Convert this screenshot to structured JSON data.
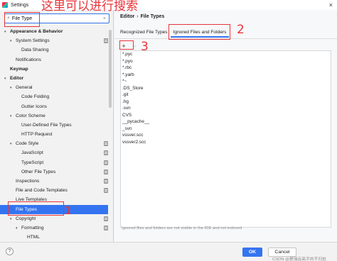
{
  "window": {
    "title": "Settings",
    "close_glyph": "×"
  },
  "search": {
    "value": "File Type",
    "icon": "search-icon",
    "clear_glyph": "×"
  },
  "tree": [
    {
      "label": "Appearance & Behavior",
      "arrow": "▾",
      "depth": 0,
      "bold": true
    },
    {
      "label": "System Settings",
      "arrow": "▾",
      "depth": 1,
      "project": true
    },
    {
      "label": "Data Sharing",
      "arrow": "",
      "depth": 2
    },
    {
      "label": "Notifications",
      "arrow": "",
      "depth": 1
    },
    {
      "label": "Keymap",
      "arrow": "",
      "depth": 0,
      "bold": true
    },
    {
      "label": "Editor",
      "arrow": "▾",
      "depth": 0,
      "bold": true
    },
    {
      "label": "General",
      "arrow": "▾",
      "depth": 1
    },
    {
      "label": "Code Folding",
      "arrow": "",
      "depth": 2
    },
    {
      "label": "Gutter Icons",
      "arrow": "",
      "depth": 2
    },
    {
      "label": "Color Scheme",
      "arrow": "▾",
      "depth": 1
    },
    {
      "label": "User-Defined File Types",
      "arrow": "",
      "depth": 2
    },
    {
      "label": "HTTP Request",
      "arrow": "",
      "depth": 2
    },
    {
      "label": "Code Style",
      "arrow": "▾",
      "depth": 1,
      "project": true
    },
    {
      "label": "JavaScript",
      "arrow": "",
      "depth": 2,
      "project": true
    },
    {
      "label": "TypeScript",
      "arrow": "",
      "depth": 2,
      "project": true
    },
    {
      "label": "Other File Types",
      "arrow": "",
      "depth": 2,
      "project": true
    },
    {
      "label": "Inspections",
      "arrow": "",
      "depth": 1,
      "project": true
    },
    {
      "label": "File and Code Templates",
      "arrow": "",
      "depth": 1,
      "project": true
    },
    {
      "label": "Live Templates",
      "arrow": "",
      "depth": 1
    },
    {
      "label": "File Types",
      "arrow": "",
      "depth": 1,
      "selected": true
    },
    {
      "label": "Copyright",
      "arrow": "▾",
      "depth": 1,
      "project": true
    },
    {
      "label": "Formatting",
      "arrow": "▾",
      "depth": 2,
      "project": true
    },
    {
      "label": "HTML",
      "arrow": "",
      "depth": 3
    }
  ],
  "breadcrumb": {
    "root": "Editor",
    "separator": "›",
    "current": "File Types"
  },
  "tabs": [
    {
      "label": "Recognized File Types",
      "active": false
    },
    {
      "label": "Ignored Files and Folders",
      "active": true
    }
  ],
  "toolbar": {
    "add": "+",
    "remove": "−"
  },
  "ignored_list": [
    "*.pyc",
    "*.pyo",
    "*.rbc",
    "*.yarb",
    "*~",
    ".DS_Store",
    ".git",
    ".hg",
    ".svn",
    "CVS",
    "__pycache__",
    "_svn",
    "vssver.scc",
    "vssver2.scc"
  ],
  "hint": "Ignored files and folders are not visible in the IDE and not indexed",
  "footer": {
    "help": "?",
    "ok": "OK",
    "cancel": "Cancel",
    "watermark": "CSDN @是瑞云高手的不归处"
  },
  "annotations": {
    "search_note": "这里可以进行搜索",
    "tab_number": "2",
    "add_number": "3",
    "file_types_number": "1",
    "color": "#e8343a"
  },
  "colors": {
    "accent": "#3574f0",
    "selection_text": "#ffffff"
  }
}
